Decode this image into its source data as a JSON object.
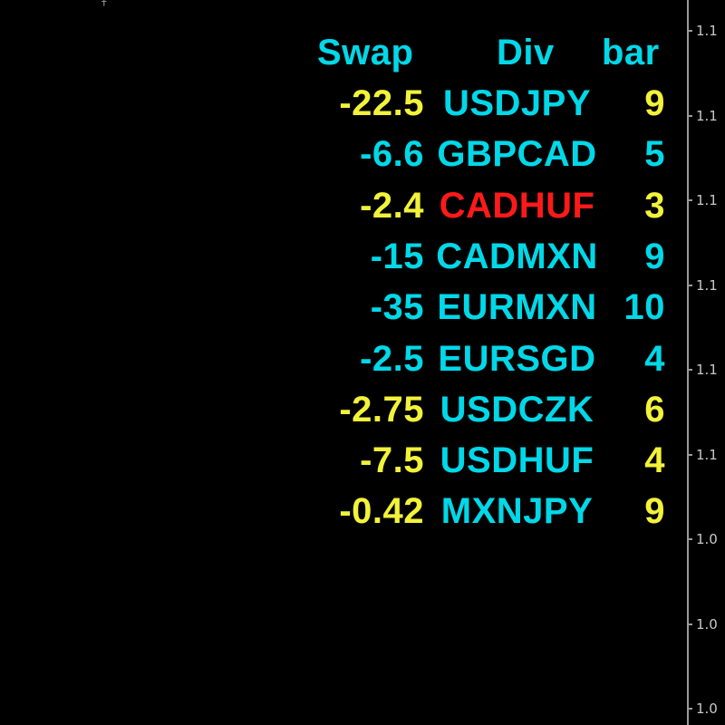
{
  "colors": {
    "background": "#000000",
    "header": "#00d8e8",
    "swap_yellow": "#f2f23a",
    "cyan": "#00d8e8",
    "red": "#ff1a1a",
    "axis_line": "#9a9a9a",
    "axis_text": "#c8c8c8"
  },
  "table": {
    "headers": {
      "swap": "Swap",
      "div": "Div",
      "bar": "bar"
    },
    "rows": [
      {
        "swap": "-22.5",
        "div": "USDJPY",
        "bar": "9",
        "swap_color": "yellow",
        "div_color": "cyan",
        "bar_color": "yellow"
      },
      {
        "swap": "-6.6",
        "div": "GBPCAD",
        "bar": "5",
        "swap_color": "cyan",
        "div_color": "cyan",
        "bar_color": "cyan"
      },
      {
        "swap": "-2.4",
        "div": "CADHUF",
        "bar": "3",
        "swap_color": "yellow",
        "div_color": "red",
        "bar_color": "yellow"
      },
      {
        "swap": "-15",
        "div": "CADMXN",
        "bar": "9",
        "swap_color": "cyan",
        "div_color": "cyan",
        "bar_color": "cyan"
      },
      {
        "swap": "-35",
        "div": "EURMXN",
        "bar": "10",
        "swap_color": "cyan",
        "div_color": "cyan",
        "bar_color": "cyan"
      },
      {
        "swap": "-2.5",
        "div": "EURSGD",
        "bar": "4",
        "swap_color": "cyan",
        "div_color": "cyan",
        "bar_color": "cyan"
      },
      {
        "swap": "-2.75",
        "div": "USDCZK",
        "bar": "6",
        "swap_color": "yellow",
        "div_color": "cyan",
        "bar_color": "yellow"
      },
      {
        "swap": "-7.5",
        "div": "USDHUF",
        "bar": "4",
        "swap_color": "yellow",
        "div_color": "cyan",
        "bar_color": "yellow"
      },
      {
        "swap": "-0.42",
        "div": "MXNJPY",
        "bar": "9",
        "swap_color": "yellow",
        "div_color": "cyan",
        "bar_color": "yellow"
      }
    ]
  },
  "price_axis": {
    "labels": [
      "1.1",
      "1.1",
      "1.1",
      "1.1",
      "1.1",
      "1.1",
      "1.0",
      "1.0",
      "1.0"
    ]
  }
}
